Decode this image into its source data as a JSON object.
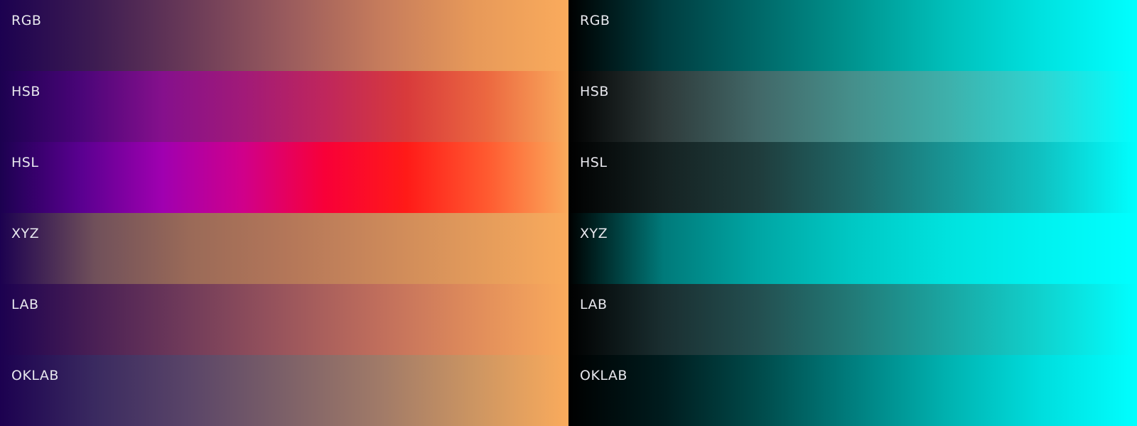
{
  "panels": [
    {
      "strips": [
        {
          "label": "RGB",
          "stops": [
            "#1c0150",
            "#3d1c52",
            "#6a3a58",
            "#985a5d",
            "#c57b5c",
            "#e79959",
            "#faab5c"
          ]
        },
        {
          "label": "HSB",
          "stops": [
            "#1c0150",
            "#4a0578",
            "#85108c",
            "#a11a78",
            "#bf265c",
            "#d83a3b",
            "#ec6840",
            "#faab5c"
          ]
        },
        {
          "label": "HSL",
          "stops": [
            "#1c0150",
            "#5a0090",
            "#a000b0",
            "#d0008a",
            "#f80038",
            "#ff1a18",
            "#ff5a30",
            "#faab5c"
          ]
        },
        {
          "label": "XYZ",
          "stops": [
            "#1c0150",
            "#70505a",
            "#9a6a58",
            "#b37659",
            "#cb885a",
            "#e29a5b",
            "#faab5c"
          ]
        },
        {
          "label": "LAB",
          "stops": [
            "#1c0150",
            "#4a2055",
            "#723c5a",
            "#9a555c",
            "#c06e5c",
            "#e08c5b",
            "#faab5c"
          ]
        },
        {
          "label": "OKLAB",
          "stops": [
            "#1c0150",
            "#3a2a60",
            "#5a4568",
            "#7c6068",
            "#a07a68",
            "#cc9562",
            "#faab5c"
          ]
        }
      ]
    },
    {
      "strips": [
        {
          "label": "RGB",
          "stops": [
            "#000000",
            "#003d40",
            "#006868",
            "#00948f",
            "#00bfba",
            "#00e2e0",
            "#00ffff"
          ]
        },
        {
          "label": "HSB",
          "stops": [
            "#000000",
            "#2e3a3a",
            "#426868",
            "#458f8b",
            "#3eb0ab",
            "#2ed5d2",
            "#00ffff"
          ]
        },
        {
          "label": "HSL",
          "stops": [
            "#000000",
            "#152222",
            "#1f3c3c",
            "#1f6666",
            "#189494",
            "#10c2c2",
            "#00ffff"
          ]
        },
        {
          "label": "XYZ",
          "stops": [
            "#000000",
            "#007a7a",
            "#00a6a4",
            "#00c8c4",
            "#00e2de",
            "#00f2f0",
            "#00ffff"
          ]
        },
        {
          "label": "LAB",
          "stops": [
            "#000000",
            "#1a2e30",
            "#234f50",
            "#227a77",
            "#1aa6a2",
            "#10d2ce",
            "#00ffff"
          ]
        },
        {
          "label": "OKLAB",
          "stops": [
            "#000000",
            "#001c1e",
            "#004a4a",
            "#007e7e",
            "#00b2b0",
            "#00dede",
            "#00ffff"
          ]
        }
      ]
    }
  ]
}
